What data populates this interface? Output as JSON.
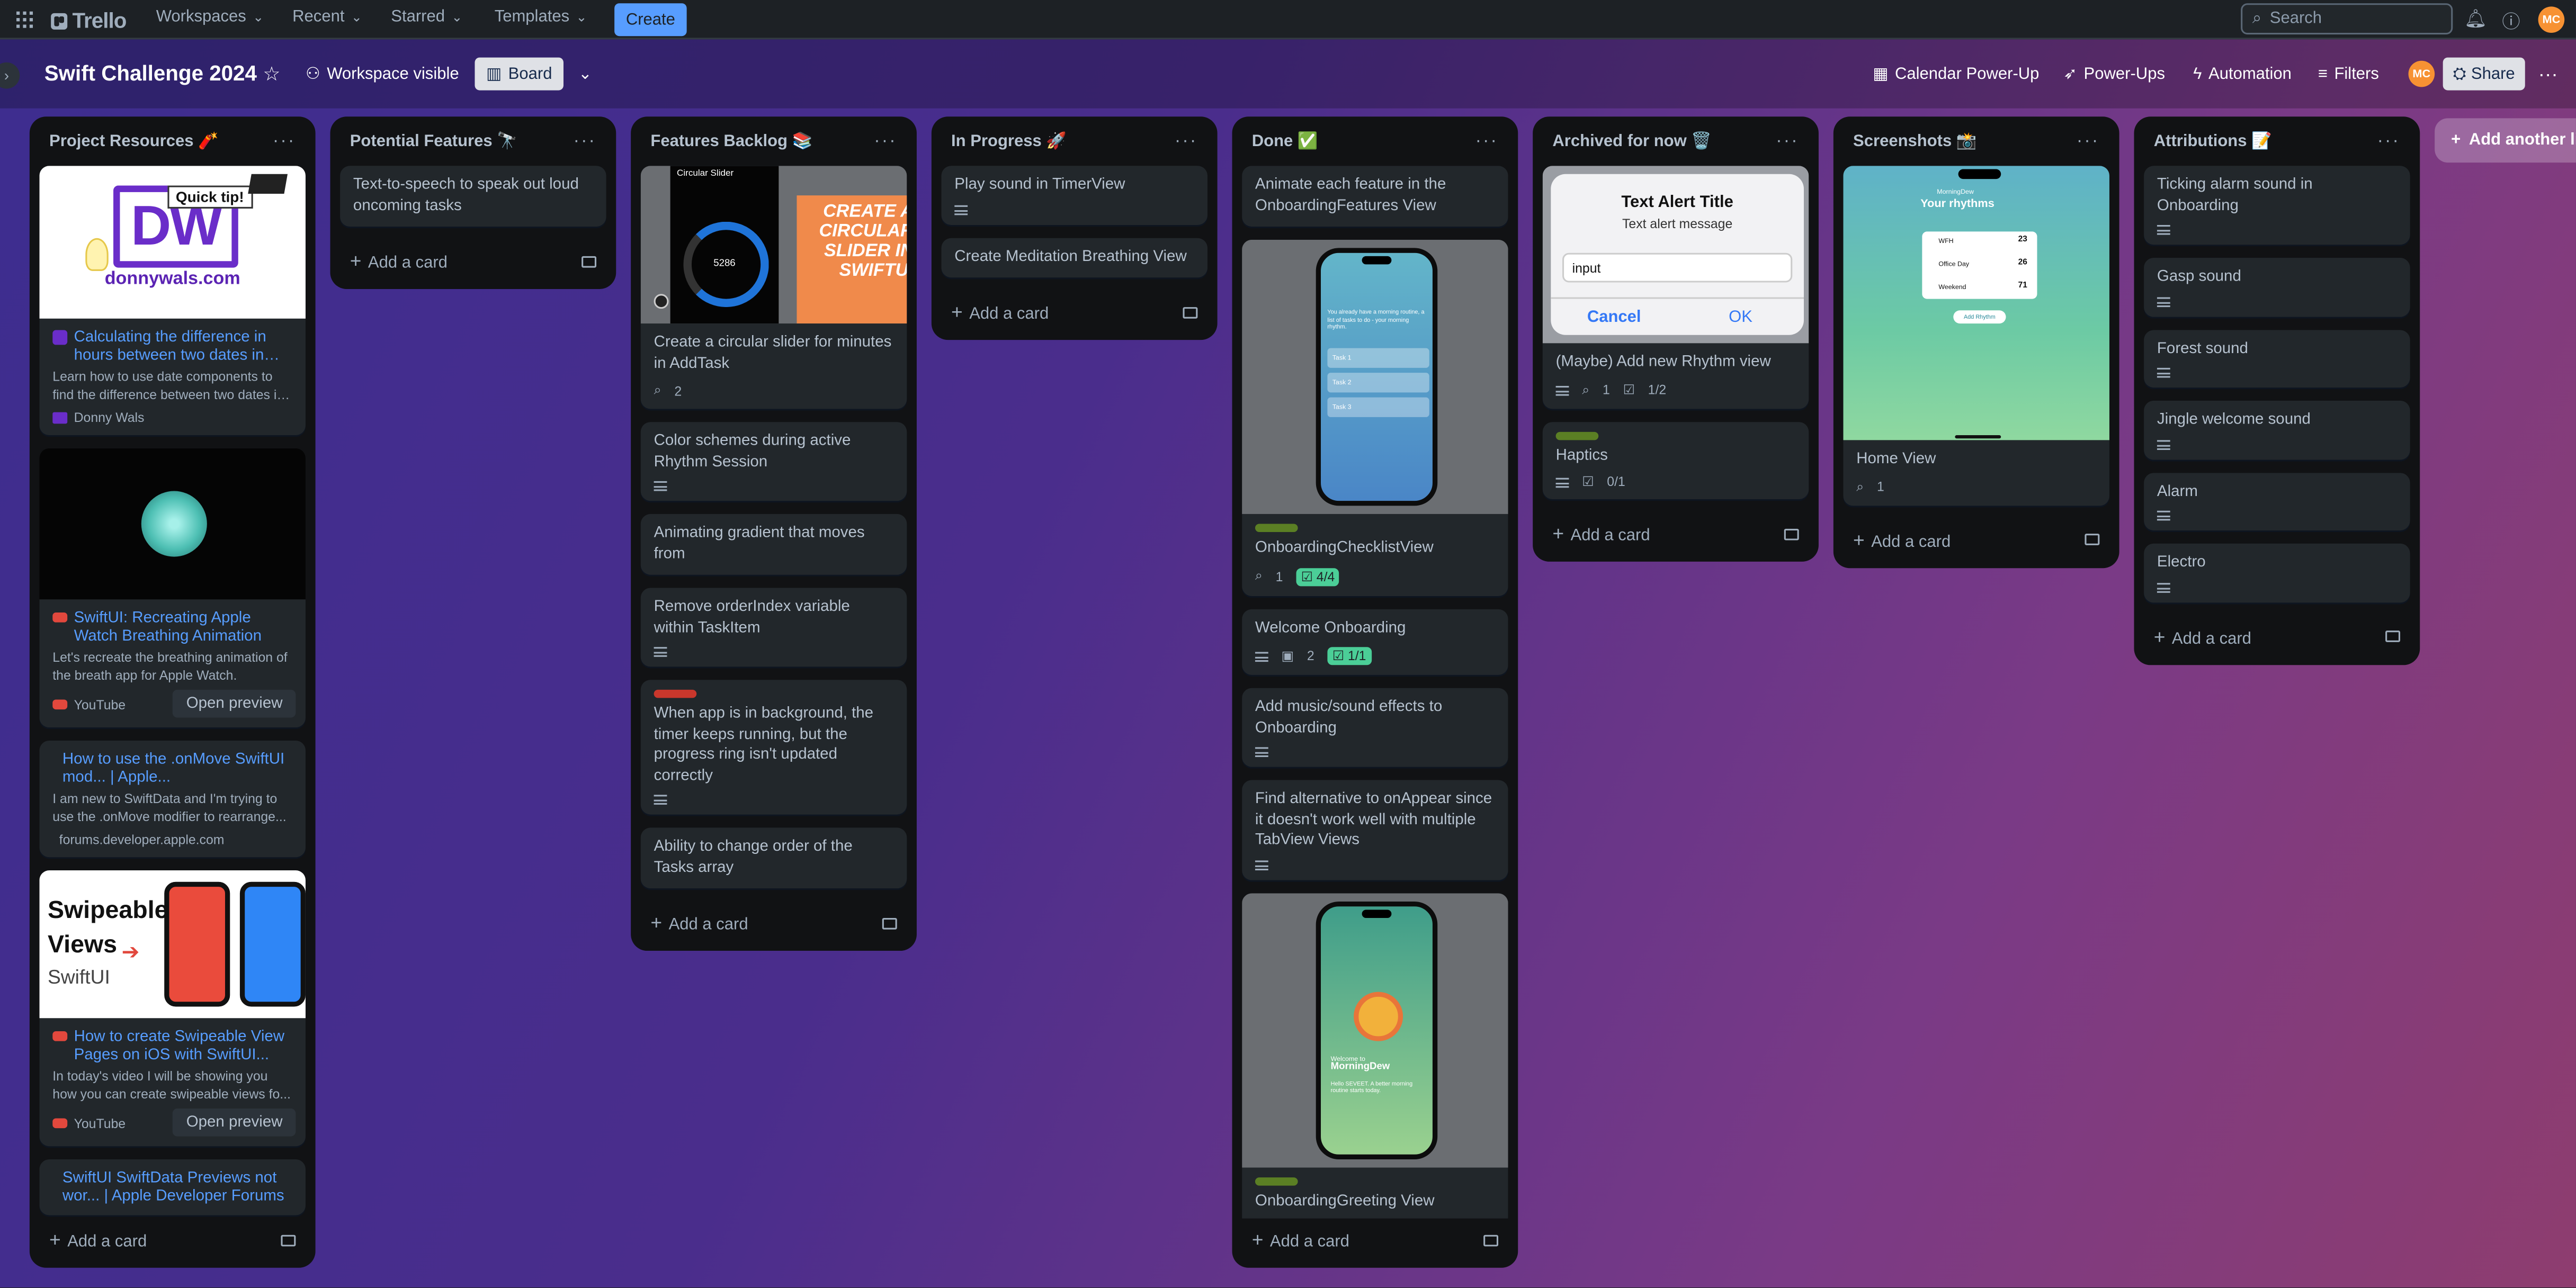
{
  "topnav": {
    "logo": "Trello",
    "menus": [
      "Workspaces",
      "Recent",
      "Starred",
      "Templates"
    ],
    "create": "Create",
    "search_placeholder": "Search",
    "avatar": "MC"
  },
  "board_header": {
    "title": "Swift Challenge 2024",
    "visibility": "Workspace visible",
    "view": "Board",
    "calendar": "Calendar Power-Up",
    "powerups": "Power-Ups",
    "automation": "Automation",
    "filters": "Filters",
    "avatar": "MC",
    "share": "Share"
  },
  "add_card_label": "Add a card",
  "add_list_label": "Add another list",
  "lists": {
    "resources": {
      "title": "Project Resources 🧨",
      "c1": {
        "cover_tip": "Quick tip!",
        "cover_logo": "DW",
        "cover_site": "donnywals.com",
        "title": "Calculating the difference in hours between two dates in…",
        "desc": "Learn how to use date components to find the difference between two dates i…",
        "source": "Donny Wals"
      },
      "c2": {
        "title": "SwiftUI: Recreating Apple Watch Breathing Animation",
        "desc": "Let's recreate the breathing animation of the breath app for Apple Watch.",
        "source": "YouTube",
        "preview": "Open preview"
      },
      "c3": {
        "title": "How to use the .onMove SwiftUI mod... | Apple...",
        "desc": "I am new to SwiftData and I'm trying to use the .onMove modifier to rearrange...",
        "source": "forums.developer.apple.com"
      },
      "c4": {
        "cover_line1": "Swipeable",
        "cover_line2": "Views",
        "cover_line3": "SwiftUI",
        "title": "How to create Swipeable View Pages on iOS with SwiftUI...",
        "desc": "In today's video I will be showing you how you can create swipeable views fo...",
        "source": "YouTube",
        "preview": "Open preview"
      },
      "c5": {
        "title": "SwiftUI SwiftData Previews not wor... | Apple Developer Forums"
      }
    },
    "potential": {
      "title": "Potential Features 🔭",
      "c1": "Text-to-speech to speak out loud oncoming tasks"
    },
    "backlog": {
      "title": "Features Backlog 📚",
      "c1": {
        "cover_label": "Circular Slider",
        "cover_value": "5286",
        "cover_overlay": "CREATE A CIRCULAR SLIDER IN SWIFTUI",
        "title": "Create a circular slider for minutes in AddTask",
        "attachments": "2"
      },
      "c2": "Color schemes during active Rhythm Session",
      "c3": "Animating gradient that moves from",
      "c4": "Remove orderIndex variable within TaskItem",
      "c5": "When app is in background, the timer keeps running, but the progress ring isn't updated correctly",
      "c6": "Ability to change order of the Tasks array"
    },
    "progress": {
      "title": "In Progress 🚀",
      "c1": "Play sound in TimerView",
      "c2": "Create Meditation Breathing View"
    },
    "done": {
      "title": "Done ✅",
      "c1": "Animate each feature in the OnboardingFeatures View",
      "c2": {
        "title": "OnboardingChecklistView",
        "attachments": "1",
        "checklist": "4/4",
        "screen_text": "You already have a morning routine, a list of tasks to do - your morning rhythm.",
        "tasks": [
          "Task 1",
          "Task 2",
          "Task 3"
        ]
      },
      "c3": {
        "title": "Welcome Onboarding",
        "images": "2",
        "checklist": "1/1"
      },
      "c4": "Add music/sound effects to Onboarding",
      "c5": "Find alternative to onAppear since it doesn't work well with multiple TabView Views",
      "c6": {
        "title": "OnboardingGreeting View",
        "screen_welcome": "Welcome to",
        "screen_app": "MorningDew",
        "screen_sub": "Hello SEVEET. A better morning routine starts today."
      }
    },
    "archived": {
      "title": "Archived for now 🗑️",
      "c1": {
        "alert_title": "Text Alert Title",
        "alert_msg": "Text alert message",
        "alert_input": "input",
        "cancel": "Cancel",
        "ok": "OK",
        "title": "(Maybe) Add new Rhythm view",
        "attachments": "1",
        "checklist": "1/2"
      },
      "c2": {
        "title": "Haptics",
        "checklist": "0/1"
      }
    },
    "screenshots": {
      "title": "Screenshots 📸",
      "c1": {
        "app_name": "MorningDew",
        "screen_title": "Your rhythms",
        "rows": [
          {
            "name": "WFH",
            "num": "23"
          },
          {
            "name": "Office Day",
            "num": "26"
          },
          {
            "name": "Weekend",
            "num": "71"
          }
        ],
        "screen_btn": "Add Rhythm",
        "title": "Home View",
        "attachments": "1"
      }
    },
    "attributions": {
      "title": "Attributions 📝",
      "cards": [
        "Ticking alarm sound in Onboarding",
        "Gasp sound",
        "Forest sound",
        "Jingle welcome sound",
        "Alarm",
        "Electro"
      ]
    }
  }
}
